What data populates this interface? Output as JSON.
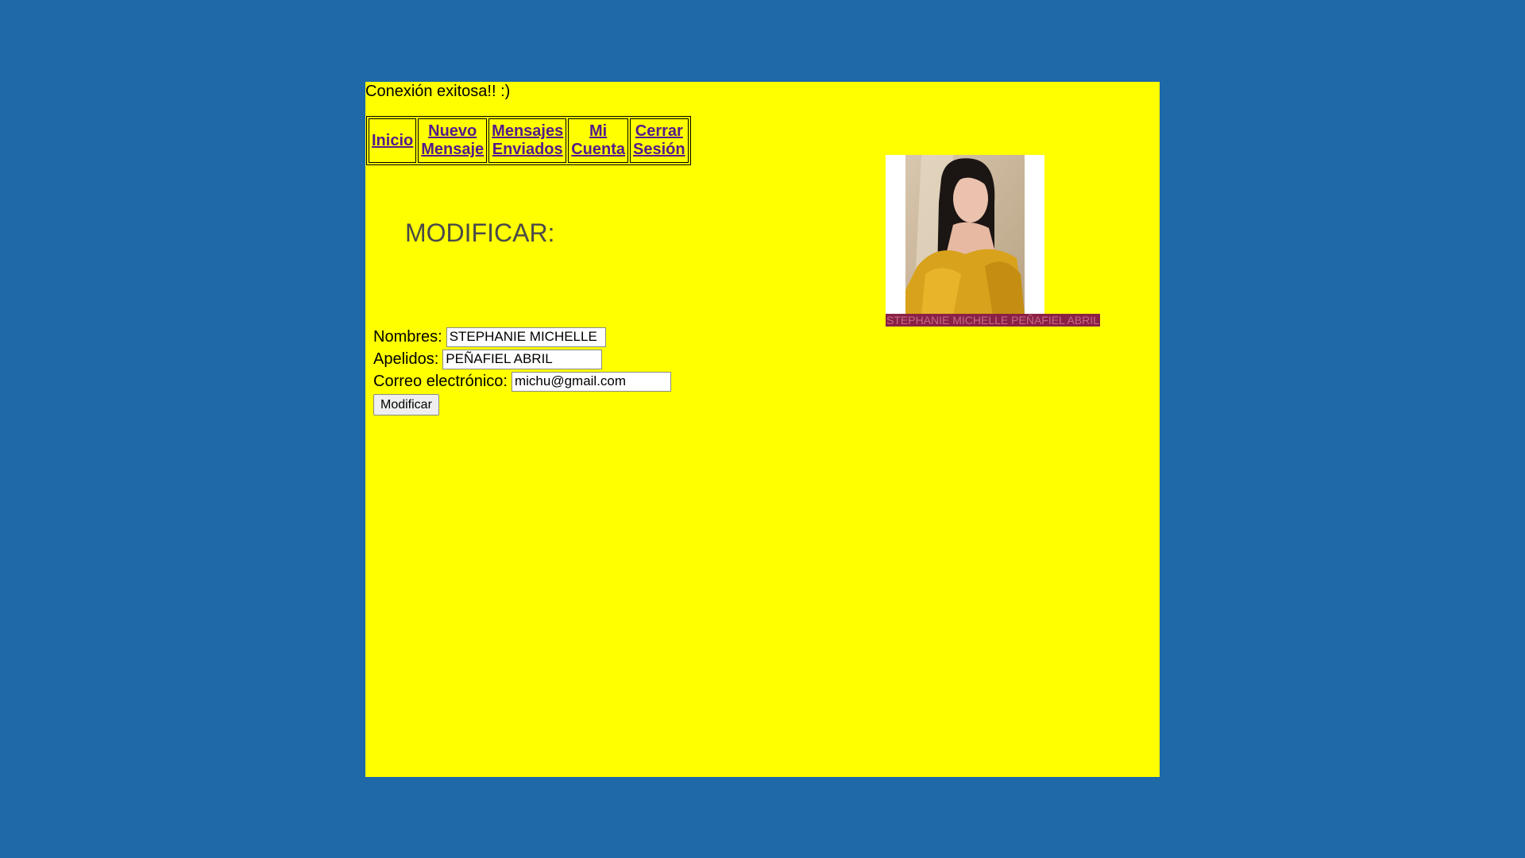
{
  "status_message": "Conexión exitosa!! :)",
  "nav": [
    {
      "line1": "Inicio",
      "line2": ""
    },
    {
      "line1": "Nuevo",
      "line2": "Mensaje"
    },
    {
      "line1": "Mensajes",
      "line2": "Enviados"
    },
    {
      "line1": "Mi",
      "line2": "Cuenta"
    },
    {
      "line1": "Cerrar",
      "line2": "Sesión"
    }
  ],
  "heading": "MODIFICAR:",
  "form": {
    "nombres_label": "Nombres:",
    "nombres_value": "STEPHANIE MICHELLE",
    "apellidos_label": "Apelidos:",
    "apellidos_value": "PEÑAFIEL ABRIL",
    "correo_label": "Correo electrónico:",
    "correo_value": "michu@gmail.com",
    "submit_label": "Modificar"
  },
  "profile": {
    "name_caption": "STEPHANIE MICHELLE PEÑAFIEL ABRIL"
  },
  "colors": {
    "background": "#1f69a8",
    "page": "#ffff00",
    "link": "#551a8b",
    "caption_bg": "#8b2046"
  }
}
